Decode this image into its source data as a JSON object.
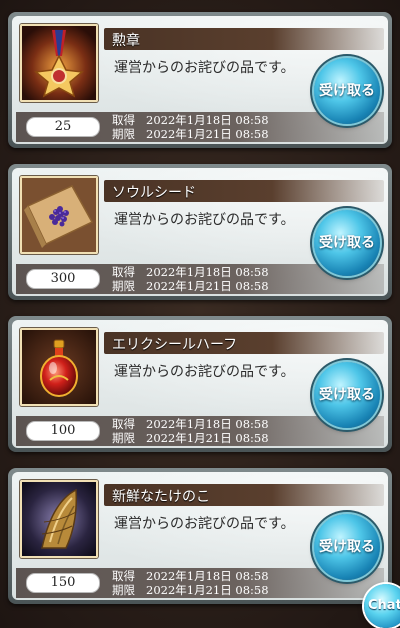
{
  "items": [
    {
      "title": "勲章",
      "message": "運営からのお詫びの品です。",
      "quantity": "25",
      "acquired_label": "取得",
      "acquired_date": "2022年1月18日 08:58",
      "expiry_label": "期限",
      "expiry_date": "2022年1月21日 08:58",
      "claim_label": "受け取る",
      "icon": "medal-icon"
    },
    {
      "title": "ソウルシード",
      "message": "運営からのお詫びの品です。",
      "quantity": "300",
      "acquired_label": "取得",
      "acquired_date": "2022年1月18日 08:58",
      "expiry_label": "期限",
      "expiry_date": "2022年1月21日 08:58",
      "claim_label": "受け取る",
      "icon": "soul-seed-icon"
    },
    {
      "title": "エリクシールハーフ",
      "message": "運営からのお詫びの品です。",
      "quantity": "100",
      "acquired_label": "取得",
      "acquired_date": "2022年1月18日 08:58",
      "expiry_label": "期限",
      "expiry_date": "2022年1月21日 08:58",
      "claim_label": "受け取る",
      "icon": "elixir-half-icon"
    },
    {
      "title": "新鮮なたけのこ",
      "message": "運営からのお詫びの品です。",
      "quantity": "150",
      "acquired_label": "取得",
      "acquired_date": "2022年1月18日 08:58",
      "expiry_label": "期限",
      "expiry_date": "2022年1月21日 08:58",
      "claim_label": "受け取る",
      "icon": "bamboo-shoot-icon"
    }
  ],
  "chat_label": "Chat",
  "colors": {
    "claim_button": "#2aa6d4",
    "title_bar": "#4a3325",
    "card_body": "#e6ecec"
  }
}
